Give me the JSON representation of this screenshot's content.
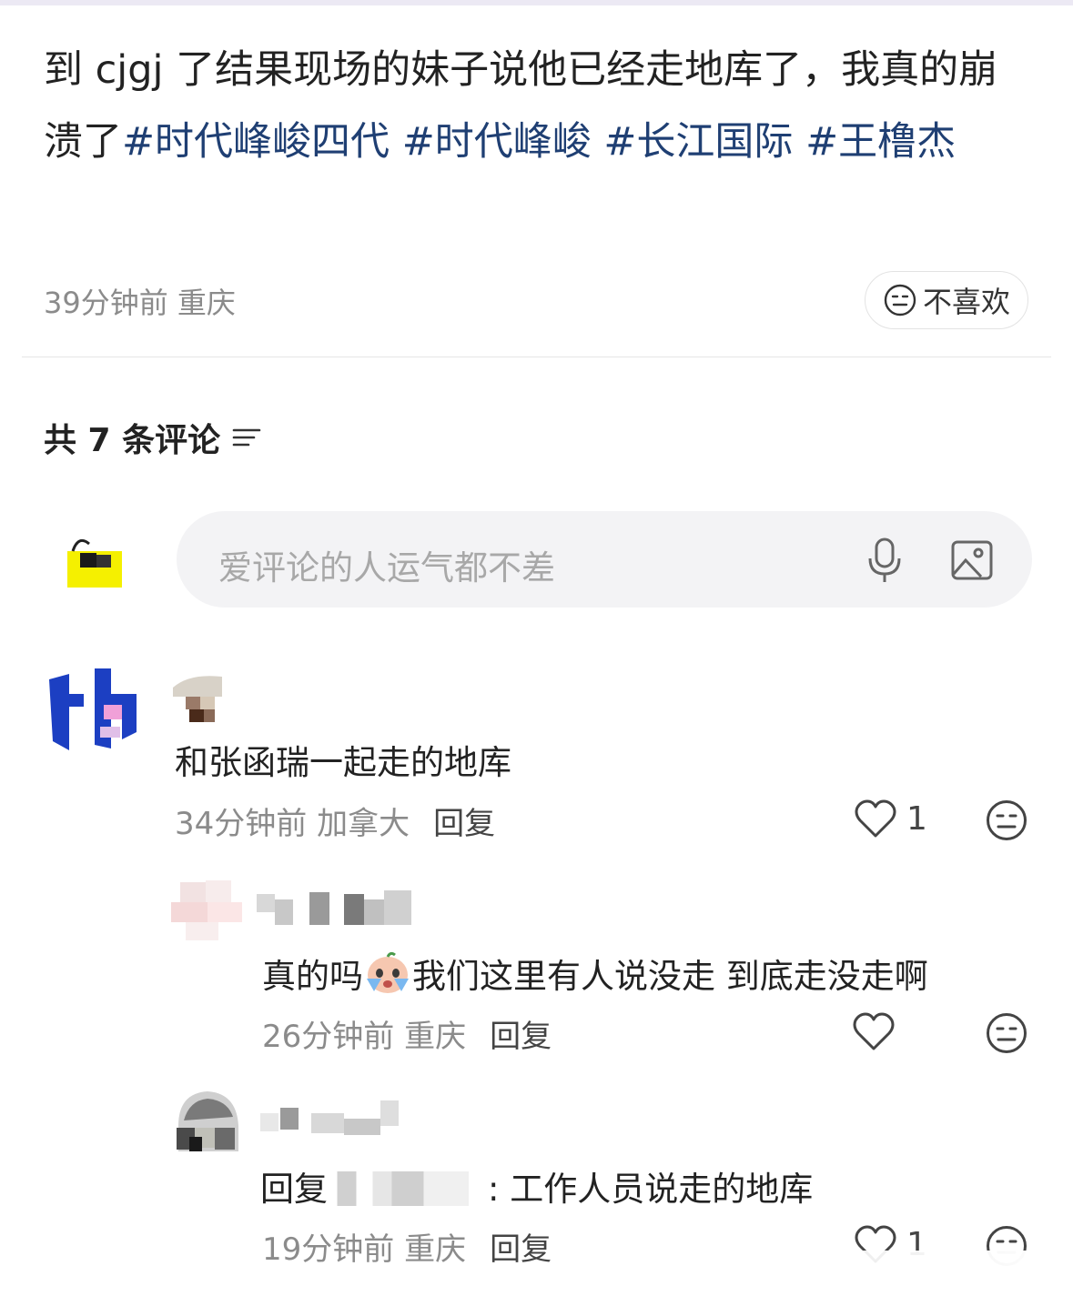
{
  "post": {
    "text": "到 cjgj 了结果现场的妹子说他已经走地库了，我真的崩溃了",
    "tags": [
      "#时代峰峻四代",
      "#时代峰峻",
      "#长江国际",
      "#王橹杰"
    ],
    "time": "39分钟前",
    "location": "重庆",
    "dislike_label": "不喜欢"
  },
  "comments_header": {
    "count_label": "共 7 条评论"
  },
  "comment_input": {
    "placeholder": "爱评论的人运气都不差"
  },
  "comments": [
    {
      "text": "和张函瑞一起走的地库",
      "time": "34分钟前",
      "location": "加拿大",
      "reply_label": "回复",
      "likes": "1",
      "replies": [
        {
          "text_before": "真的吗",
          "text_after": "我们这里有人说没走 到底走没走啊",
          "time": "26分钟前",
          "location": "重庆",
          "reply_label": "回复",
          "likes": ""
        },
        {
          "text_prefix": "回复",
          "text": ": 工作人员说走的地库",
          "time": "19分钟前",
          "location": "重庆",
          "reply_label": "回复",
          "likes": "1"
        }
      ]
    }
  ],
  "colors": {
    "tag": "#1f3f73",
    "meta": "#8b8b8b",
    "input_bg": "#f3f3f5"
  }
}
